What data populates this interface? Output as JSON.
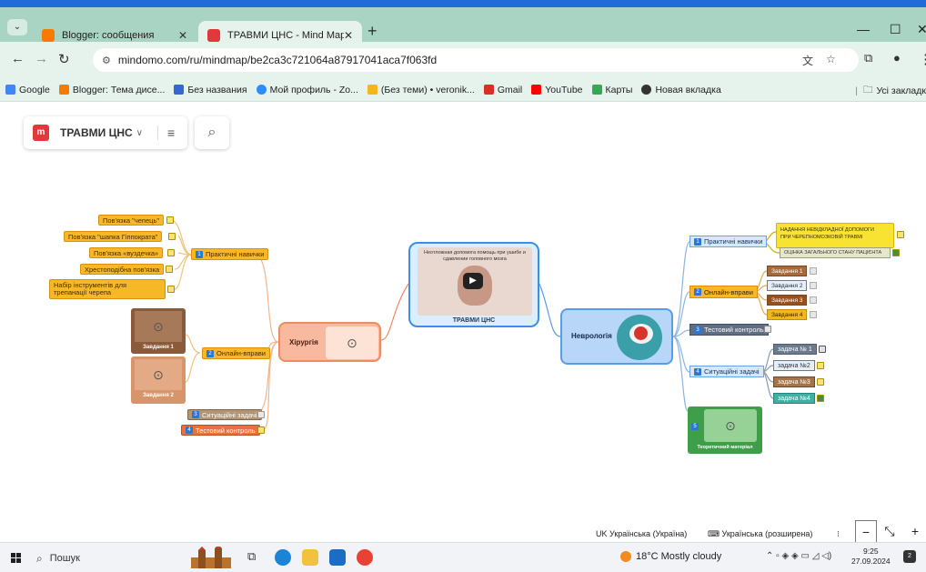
{
  "browser": {
    "tabs": [
      {
        "label": "Blogger: сообщения",
        "color": "#f57c00"
      },
      {
        "label": "ТРАВМИ ЦНС - Mind Map",
        "color": "#e0383b"
      }
    ],
    "url": "mindomo.com/ru/mindmap/be2ca3c721064a87917041aca7f063fd",
    "bookmarks": [
      {
        "label": "Google",
        "color": "#4285f4"
      },
      {
        "label": "Blogger: Тема дисе...",
        "color": "#f57c00"
      },
      {
        "label": "Без названия",
        "color": "#3367d6"
      },
      {
        "label": "Мой профиль - Zo...",
        "color": "#2d8cff"
      },
      {
        "label": "(Без теми) • veronik...",
        "color": "#f2b61f"
      },
      {
        "label": "Gmail",
        "color": "#d93025"
      },
      {
        "label": "YouTube",
        "color": "#ff0000"
      },
      {
        "label": "Карты",
        "color": "#34a853"
      },
      {
        "label": "Новая вкладка",
        "color": "#333333"
      }
    ],
    "all_bookmarks": "Усі закладк"
  },
  "toolbar": {
    "title": "ТРАВМИ ЦНС"
  },
  "mindmap": {
    "center": {
      "label": "ТРАВМИ ЦНС",
      "video_caption": "Неотложная допомога помощь при ушибе и сдавлении головного мозга"
    },
    "left": {
      "label": "Хірургія",
      "practical": {
        "label": "Практичні навички",
        "num": "1",
        "items": [
          "Пов'язка \"чепець\"",
          "Пов'язка \"шапка Гіппократа\"",
          "Пов'язка «вуздечка»",
          "Хрестоподібна пов'язка",
          "Набір інструментів для трепанації черепа"
        ]
      },
      "online": {
        "label": "Онлайн-вправи",
        "num": "2",
        "tasks": [
          "Завдання 1",
          "Завдання 2"
        ]
      },
      "situational": {
        "label": "Ситуаційні задачі",
        "num": "3"
      },
      "test": {
        "label": "Тестовий контроль",
        "num": "4"
      }
    },
    "right": {
      "label": "Неврологія",
      "practical": {
        "label": "Практичні навички",
        "num": "1",
        "items": [
          "НАДАННЯ НЕВІДКЛАДНОЇ ДОПОМОГИ ПРИ ЧЕРЕПНОМОЗКОВІЙ ТРАВМІ",
          "ОЦІНКА ЗАГАЛЬНОГО СТАНУ ПАЦІЄНТА"
        ]
      },
      "online": {
        "label": "Онлайн-вправи",
        "num": "2",
        "tasks": [
          "Завдання 1",
          "Завдання 2",
          "Завдання 3",
          "Завдання 4"
        ]
      },
      "test": {
        "label": "Тестовий контроль",
        "num": "3"
      },
      "situational": {
        "label": "Ситуаційні задачі",
        "num": "4",
        "tasks": [
          "задача № 1",
          "задача №2",
          "задача №3",
          "задача №4"
        ]
      },
      "theory": {
        "label": "Теоретичний матеріал",
        "num": "5"
      }
    }
  },
  "status": {
    "lang1": "UK Українська (Україна)",
    "lang2": "Українська (розширена)"
  },
  "taskbar": {
    "search": "Пошук",
    "weather": "18°C  Mostly cloudy",
    "time": "9:25",
    "date": "27.09.2024",
    "notif": "2"
  }
}
